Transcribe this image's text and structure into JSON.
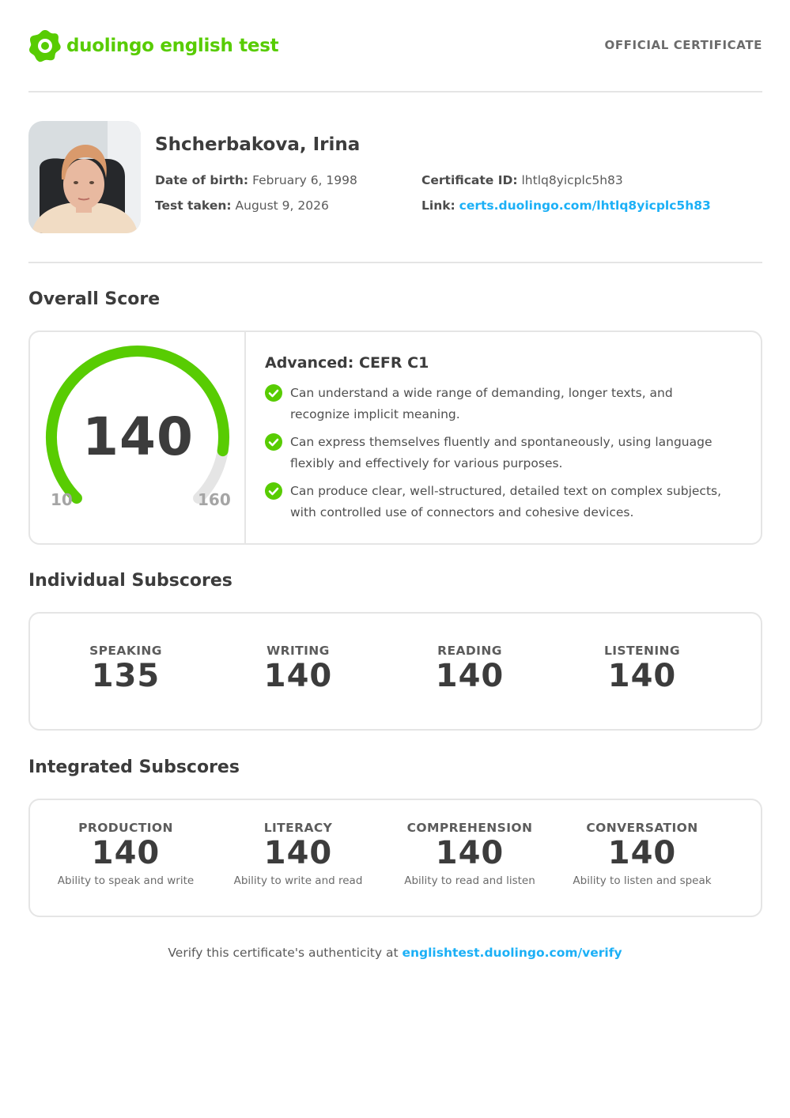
{
  "header": {
    "brand": "duolingo english test",
    "official": "OFFICIAL CERTIFICATE"
  },
  "candidate": {
    "name": "Shcherbakova, Irina",
    "dob_label": "Date of birth:",
    "dob": "February 6, 1998",
    "taken_label": "Test taken:",
    "taken": "August 9, 2026",
    "cert_label": "Certificate ID:",
    "cert_id": "lhtlq8yicplc5h83",
    "link_label": "Link:",
    "link": "certs.duolingo.com/lhtlq8yicplc5h83"
  },
  "overall": {
    "title": "Overall Score",
    "score": "140",
    "min": "10",
    "max": "160",
    "fill_fraction": 0.8667,
    "level": "Advanced: CEFR C1",
    "descriptors": [
      "Can understand a wide range of demanding, longer texts, and recognize implicit meaning.",
      "Can express themselves fluently and spontaneously, using language flexibly and effectively for various purposes.",
      "Can produce clear, well-structured, detailed text on complex subjects, with controlled use of connectors and cohesive devices."
    ]
  },
  "individual": {
    "title": "Individual Subscores",
    "items": [
      {
        "label": "SPEAKING",
        "score": "135"
      },
      {
        "label": "WRITING",
        "score": "140"
      },
      {
        "label": "READING",
        "score": "140"
      },
      {
        "label": "LISTENING",
        "score": "140"
      }
    ]
  },
  "integrated": {
    "title": "Integrated Subscores",
    "items": [
      {
        "label": "PRODUCTION",
        "score": "140",
        "desc": "Ability to speak and write"
      },
      {
        "label": "LITERACY",
        "score": "140",
        "desc": "Ability to write and read"
      },
      {
        "label": "COMPREHENSION",
        "score": "140",
        "desc": "Ability to read and listen"
      },
      {
        "label": "CONVERSATION",
        "score": "140",
        "desc": "Ability to listen and speak"
      }
    ]
  },
  "footer": {
    "verify_text": "Verify this certificate's authenticity at ",
    "verify_link": "englishtest.duolingo.com/verify"
  },
  "colors": {
    "brand_green": "#58cc02",
    "link_blue": "#1cb0f6",
    "gauge_track": "#e5e5e5"
  }
}
